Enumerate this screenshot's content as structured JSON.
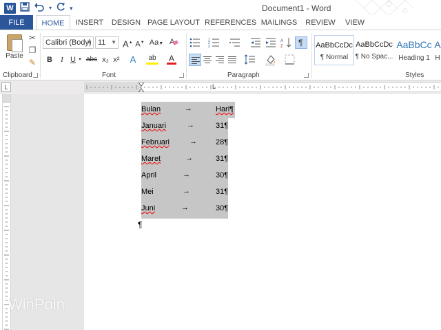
{
  "app": {
    "title": "Document1 - Word",
    "word_icon": "W",
    "quick_access": [
      "save-icon",
      "undo-icon",
      "redo-icon",
      "customize-icon"
    ]
  },
  "tabs": [
    {
      "label": "FILE"
    },
    {
      "label": "HOME"
    },
    {
      "label": "INSERT"
    },
    {
      "label": "DESIGN"
    },
    {
      "label": "PAGE LAYOUT"
    },
    {
      "label": "REFERENCES"
    },
    {
      "label": "MAILINGS"
    },
    {
      "label": "REVIEW"
    },
    {
      "label": "VIEW"
    }
  ],
  "ribbon": {
    "clipboard": {
      "paste_label": "Paste",
      "group_label": "Clipboard"
    },
    "font": {
      "font_name": "Calibri (Body)",
      "font_size": "11",
      "grow": "A",
      "shrink": "A",
      "case": "Aa",
      "bold": "B",
      "italic": "I",
      "underline": "U",
      "strike": "abc",
      "subscript": "x₂",
      "superscript": "x²",
      "effects": "A",
      "highlight": "ab",
      "color": "A",
      "group_label": "Font"
    },
    "paragraph": {
      "group_label": "Paragraph",
      "show_marks": "¶"
    },
    "styles": {
      "group_label": "Styles",
      "items": [
        {
          "sample": "AaBbCcDc",
          "name": "¶ Normal"
        },
        {
          "sample": "AaBbCcDc",
          "name": "¶ No Spac..."
        },
        {
          "sample": "AaBbCc",
          "name": "Heading 1"
        },
        {
          "sample": "A",
          "name": "H"
        }
      ]
    }
  },
  "ruler": {
    "tab_selector": "L"
  },
  "document": {
    "rows": [
      {
        "month": "Bulan",
        "days": "Hari¶",
        "underline": true
      },
      {
        "month": "Januari",
        "days": "31¶",
        "underline": true
      },
      {
        "month": "Februari",
        "days": "28¶",
        "underline": true
      },
      {
        "month": "Maret",
        "days": "31¶",
        "underline": true
      },
      {
        "month": "April",
        "days": "30¶",
        "underline": false
      },
      {
        "month": "Mei",
        "days": "31¶",
        "underline": false
      },
      {
        "month": "Juni",
        "days": "30¶",
        "underline": true
      }
    ],
    "tab_arrow": "→",
    "end_mark": "¶"
  },
  "watermark": "WinPoin",
  "colors": {
    "accent": "#2b579a",
    "selection": "#c6c6c6",
    "heading": "#2e74b5"
  }
}
